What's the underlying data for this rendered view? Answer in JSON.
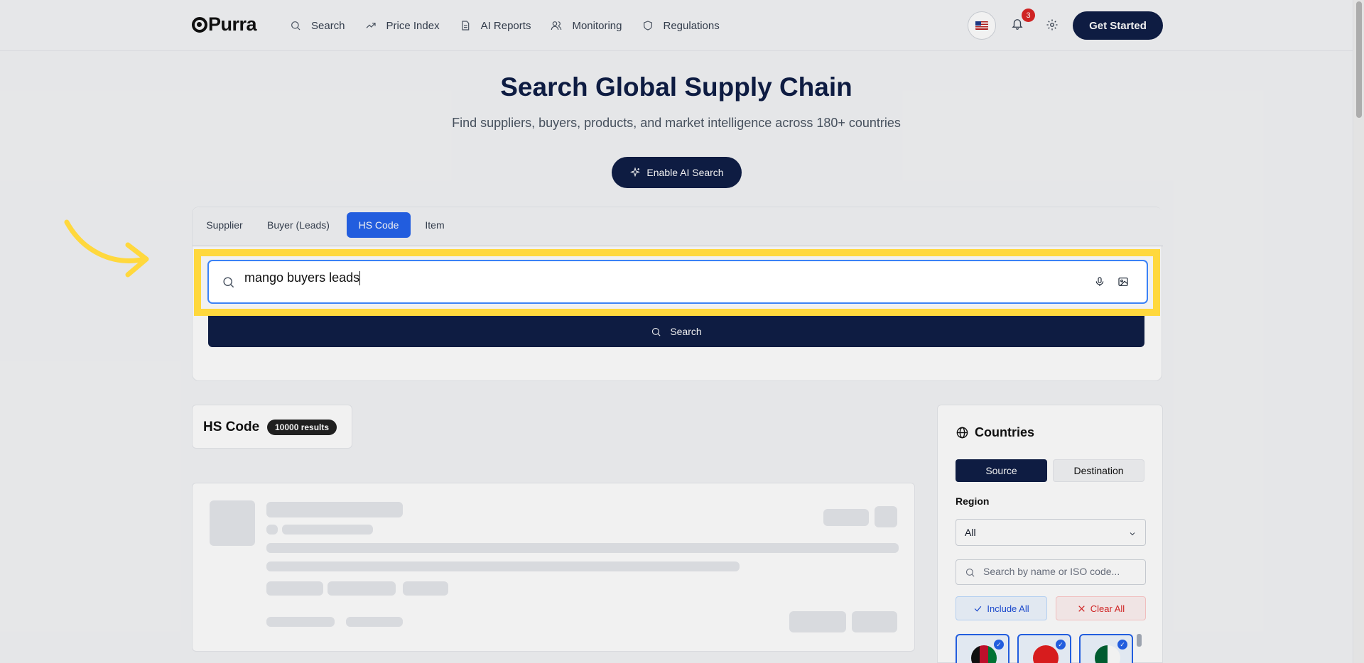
{
  "nav": {
    "brand": "Purra",
    "links": [
      {
        "label": "Search",
        "icon": "search-icon"
      },
      {
        "label": "Price Index",
        "icon": "trending-up-icon"
      },
      {
        "label": "AI Reports",
        "icon": "document-icon"
      },
      {
        "label": "Monitoring",
        "icon": "users-icon"
      },
      {
        "label": "Regulations",
        "icon": "shield-icon"
      }
    ],
    "notification_count": "3",
    "cta": "Get Started"
  },
  "hero": {
    "title": "Search Global Supply Chain",
    "subtitle": "Find suppliers, buyers, products, and market intelligence across 180+ countries",
    "ai_button": "Enable AI Search"
  },
  "search": {
    "tabs": [
      "Supplier",
      "Buyer (Leads)",
      "HS Code",
      "Item"
    ],
    "active_tab": "HS Code",
    "query": "mango buyers leads",
    "button_label": "Search"
  },
  "results": {
    "title": "HS Code",
    "count": "10000 results"
  },
  "countries": {
    "title": "Countries",
    "toggle": [
      "Source",
      "Destination"
    ],
    "active_toggle": "Source",
    "region_label": "Region",
    "region_value": "All",
    "search_placeholder": "Search by name or ISO code...",
    "include_all": "Include All",
    "clear_all": "Clear All",
    "flags": [
      "afghanistan-flag",
      "albania-flag",
      "algeria-flag"
    ]
  },
  "colors": {
    "primary": "#0f1e46",
    "accent": "#2563eb",
    "highlight": "#ffd83d",
    "danger": "#dc2626"
  }
}
